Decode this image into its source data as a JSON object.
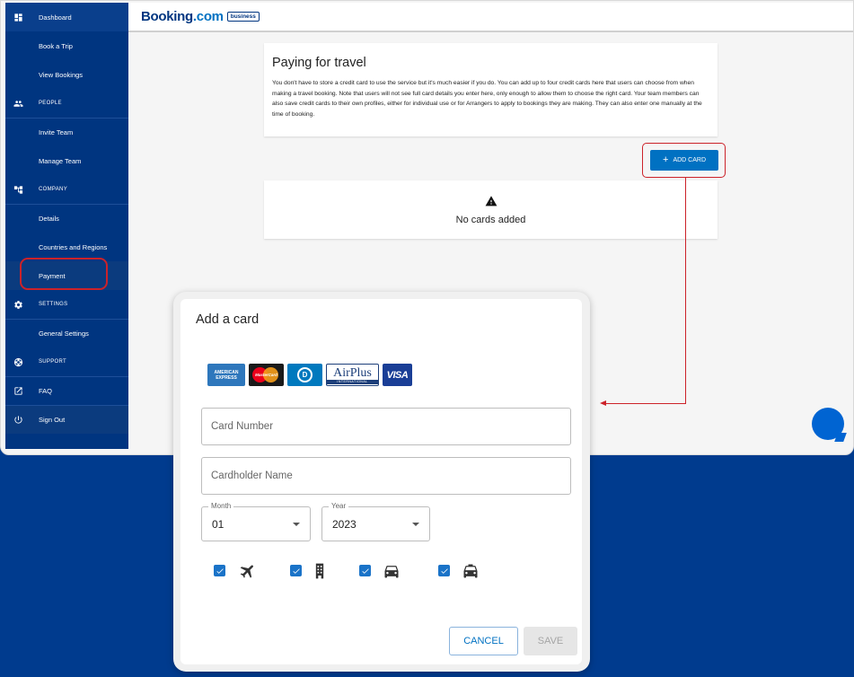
{
  "sidebar": {
    "items": [
      {
        "label": "Dashboard",
        "icon": "dashboard-icon"
      },
      {
        "label": "Book a Trip"
      },
      {
        "label": "View Bookings"
      },
      {
        "label": "PEOPLE",
        "icon": "people-icon"
      },
      {
        "label": "Invite Team"
      },
      {
        "label": "Manage Team"
      },
      {
        "label": "COMPANY",
        "icon": "company-icon"
      },
      {
        "label": "Details"
      },
      {
        "label": "Countries and Regions"
      },
      {
        "label": "Payment"
      },
      {
        "label": "SETTINGS",
        "icon": "gear-icon"
      },
      {
        "label": "General Settings"
      },
      {
        "label": "SUPPORT",
        "icon": "support-icon"
      },
      {
        "label": "FAQ",
        "icon": "external-link-icon"
      },
      {
        "label": "Sign Out",
        "icon": "power-icon"
      }
    ]
  },
  "header": {
    "logo_main": "Booking",
    "logo_tld": ".com",
    "logo_badge": "business"
  },
  "main": {
    "title": "Paying for travel",
    "description": "You don't have to store a credit card to use the service but it's much easier if you do. You can add up to four credit cards here that users can choose from when making a travel booking. Note that users will not see full card details you enter here, only enough to allow them to choose the right card. Your team members can also save credit cards to their own profiles, either for individual use or for Arrangers to apply to bookings they are making. They can also enter one manually at the time of booking.",
    "add_card_label": "ADD CARD",
    "empty_text": "No cards added"
  },
  "modal": {
    "title": "Add a card",
    "card_logos": {
      "amex_line1": "AMERICAN",
      "amex_line2": "EXPRESS",
      "mastercard": "MasterCard",
      "diners": "D",
      "airplus": "AirPlus",
      "airplus_sub": "INTERNATIONAL",
      "visa": "VISA"
    },
    "card_number_placeholder": "Card Number",
    "cardholder_placeholder": "Cardholder Name",
    "month_label": "Month",
    "month_value": "01",
    "year_label": "Year",
    "year_value": "2023",
    "travel_types": [
      {
        "icon": "flight-icon",
        "checked": true
      },
      {
        "icon": "hotel-icon",
        "checked": true
      },
      {
        "icon": "car-icon",
        "checked": true
      },
      {
        "icon": "taxi-icon",
        "checked": true
      }
    ],
    "cancel_label": "CANCEL",
    "save_label": "SAVE"
  },
  "colors": {
    "brand_dark": "#003580",
    "brand_blue": "#0071c2",
    "highlight_red": "#cc2229",
    "background": "#003b8e"
  }
}
